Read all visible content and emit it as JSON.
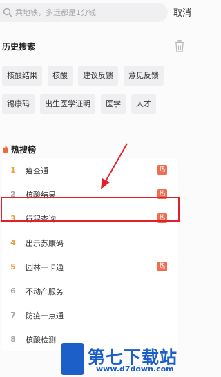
{
  "search": {
    "placeholder": "乘地铁，多远都是1分钱",
    "cancel_label": "取消"
  },
  "history": {
    "title": "历史搜索",
    "rows": [
      [
        "核酸结果",
        "核酸",
        "建议反馈",
        "意见反馈"
      ],
      [
        "锡康码",
        "出生医学证明",
        "医学",
        "人才"
      ]
    ]
  },
  "hot": {
    "title": "热搜榜",
    "items": [
      {
        "rank": "1",
        "label": "疫查通",
        "tag": "热"
      },
      {
        "rank": "2",
        "label": "核酸结果",
        "tag": "热"
      },
      {
        "rank": "3",
        "label": "行程查询",
        "tag": "热"
      },
      {
        "rank": "4",
        "label": "出示苏康码",
        "tag": ""
      },
      {
        "rank": "5",
        "label": "园林一卡通",
        "tag": "热"
      },
      {
        "rank": "6",
        "label": "不动产服务",
        "tag": ""
      },
      {
        "rank": "7",
        "label": "防疫一点通",
        "tag": ""
      },
      {
        "rank": "8",
        "label": "核酸检测",
        "tag": ""
      }
    ]
  },
  "watermark": {
    "name": "第七下载站",
    "url": "www.d7down.com"
  },
  "colors": {
    "accent": "#e2202a",
    "tag": "#ee6c4f",
    "rank": "#e8a43a",
    "watermark": "#1c5fc8"
  }
}
